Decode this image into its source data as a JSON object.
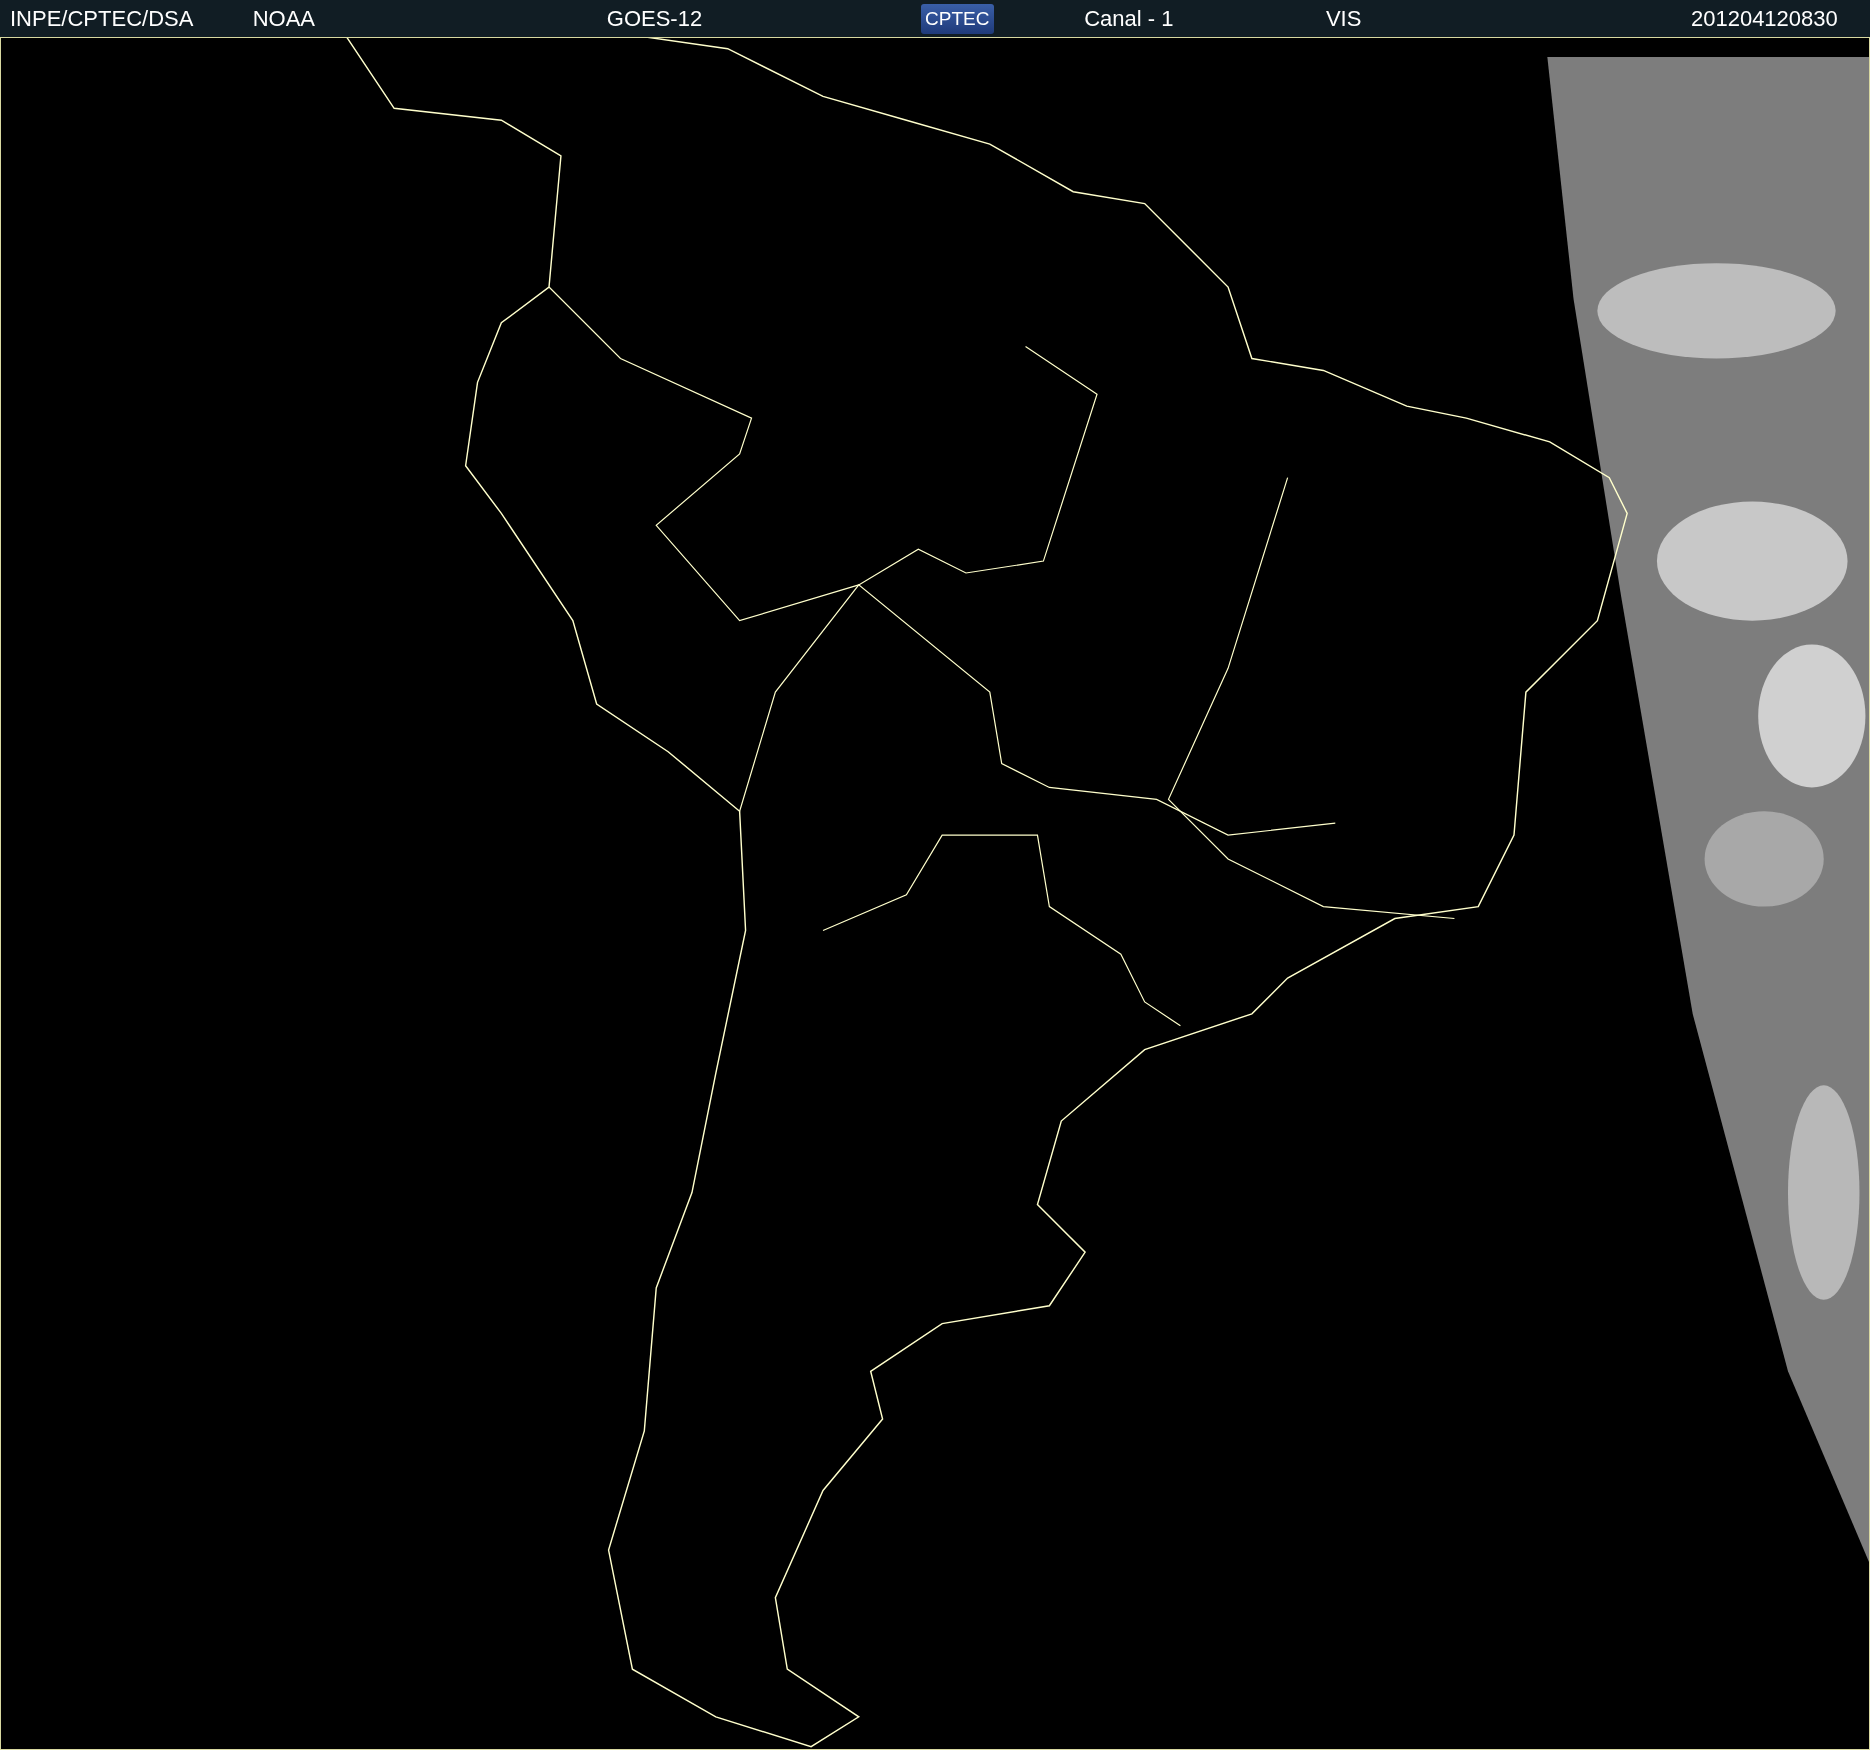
{
  "header": {
    "items": [
      {
        "kind": "text",
        "label": "INPE/CPTEC/DSA"
      },
      {
        "kind": "text",
        "label": "NOAA"
      },
      {
        "kind": "text",
        "label": "GOES-12"
      },
      {
        "kind": "logo",
        "label": "CPTEC"
      },
      {
        "kind": "text",
        "label": "Canal - 1"
      },
      {
        "kind": "text",
        "label": "VIS"
      },
      {
        "kind": "text",
        "label": "201204120830"
      }
    ]
  }
}
